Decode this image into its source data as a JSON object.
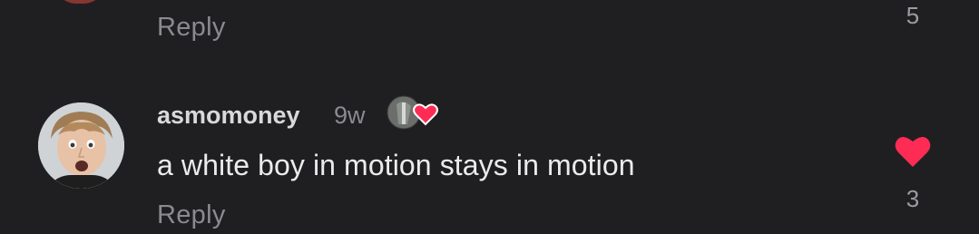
{
  "previous_comment": {
    "reply_label": "Reply",
    "like_count": "5"
  },
  "comment": {
    "username": "asmomoney",
    "time_ago": "9w",
    "text": "a white boy in motion stays in motion",
    "reply_label": "Reply",
    "like_count": "3",
    "liked": true,
    "badge_icon": "creator-liked-heart-icon",
    "like_icon": "heart-icon"
  },
  "colors": {
    "background": "#1f1f22",
    "like_red": "#fe2c55",
    "muted_text": "#8a8a8f"
  }
}
